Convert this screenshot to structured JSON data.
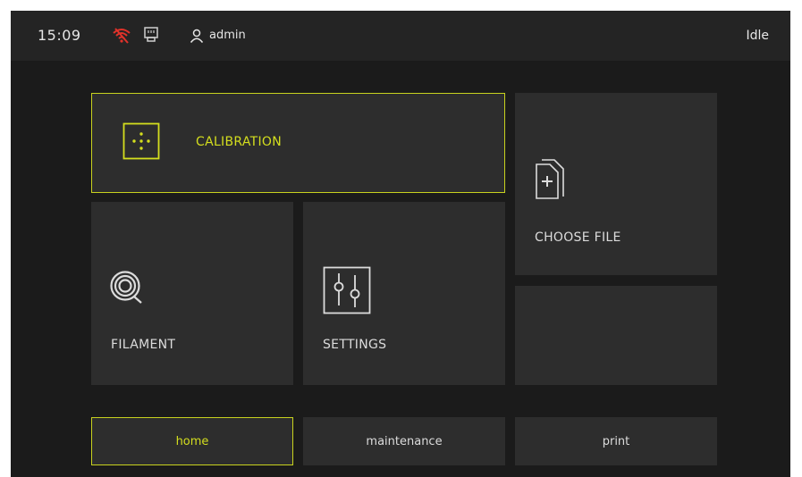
{
  "topbar": {
    "time": "15:09",
    "user": "admin",
    "status": "Idle",
    "icons": {
      "network": "wifi-disconnected-icon",
      "ethernet": "ethernet-icon",
      "user": "user-icon"
    }
  },
  "tiles": {
    "calibration": {
      "label": "CALIBRATION",
      "icon": "calibration-icon"
    },
    "choose_file": {
      "label": "CHOOSE FILE",
      "icon": "file-add-icon"
    },
    "filament": {
      "label": "FILAMENT",
      "icon": "filament-spool-icon"
    },
    "settings": {
      "label": "SETTINGS",
      "icon": "sliders-icon"
    },
    "empty": {
      "label": ""
    }
  },
  "tabs": [
    {
      "label": "home",
      "active": true
    },
    {
      "label": "maintenance",
      "active": false
    },
    {
      "label": "print",
      "active": false
    }
  ],
  "colors": {
    "accent": "#c8d21e",
    "background": "#1b1b1b",
    "topbar": "#242424",
    "tile": "#2d2d2d",
    "text": "#dcdcdc",
    "alert": "#e0322a"
  }
}
